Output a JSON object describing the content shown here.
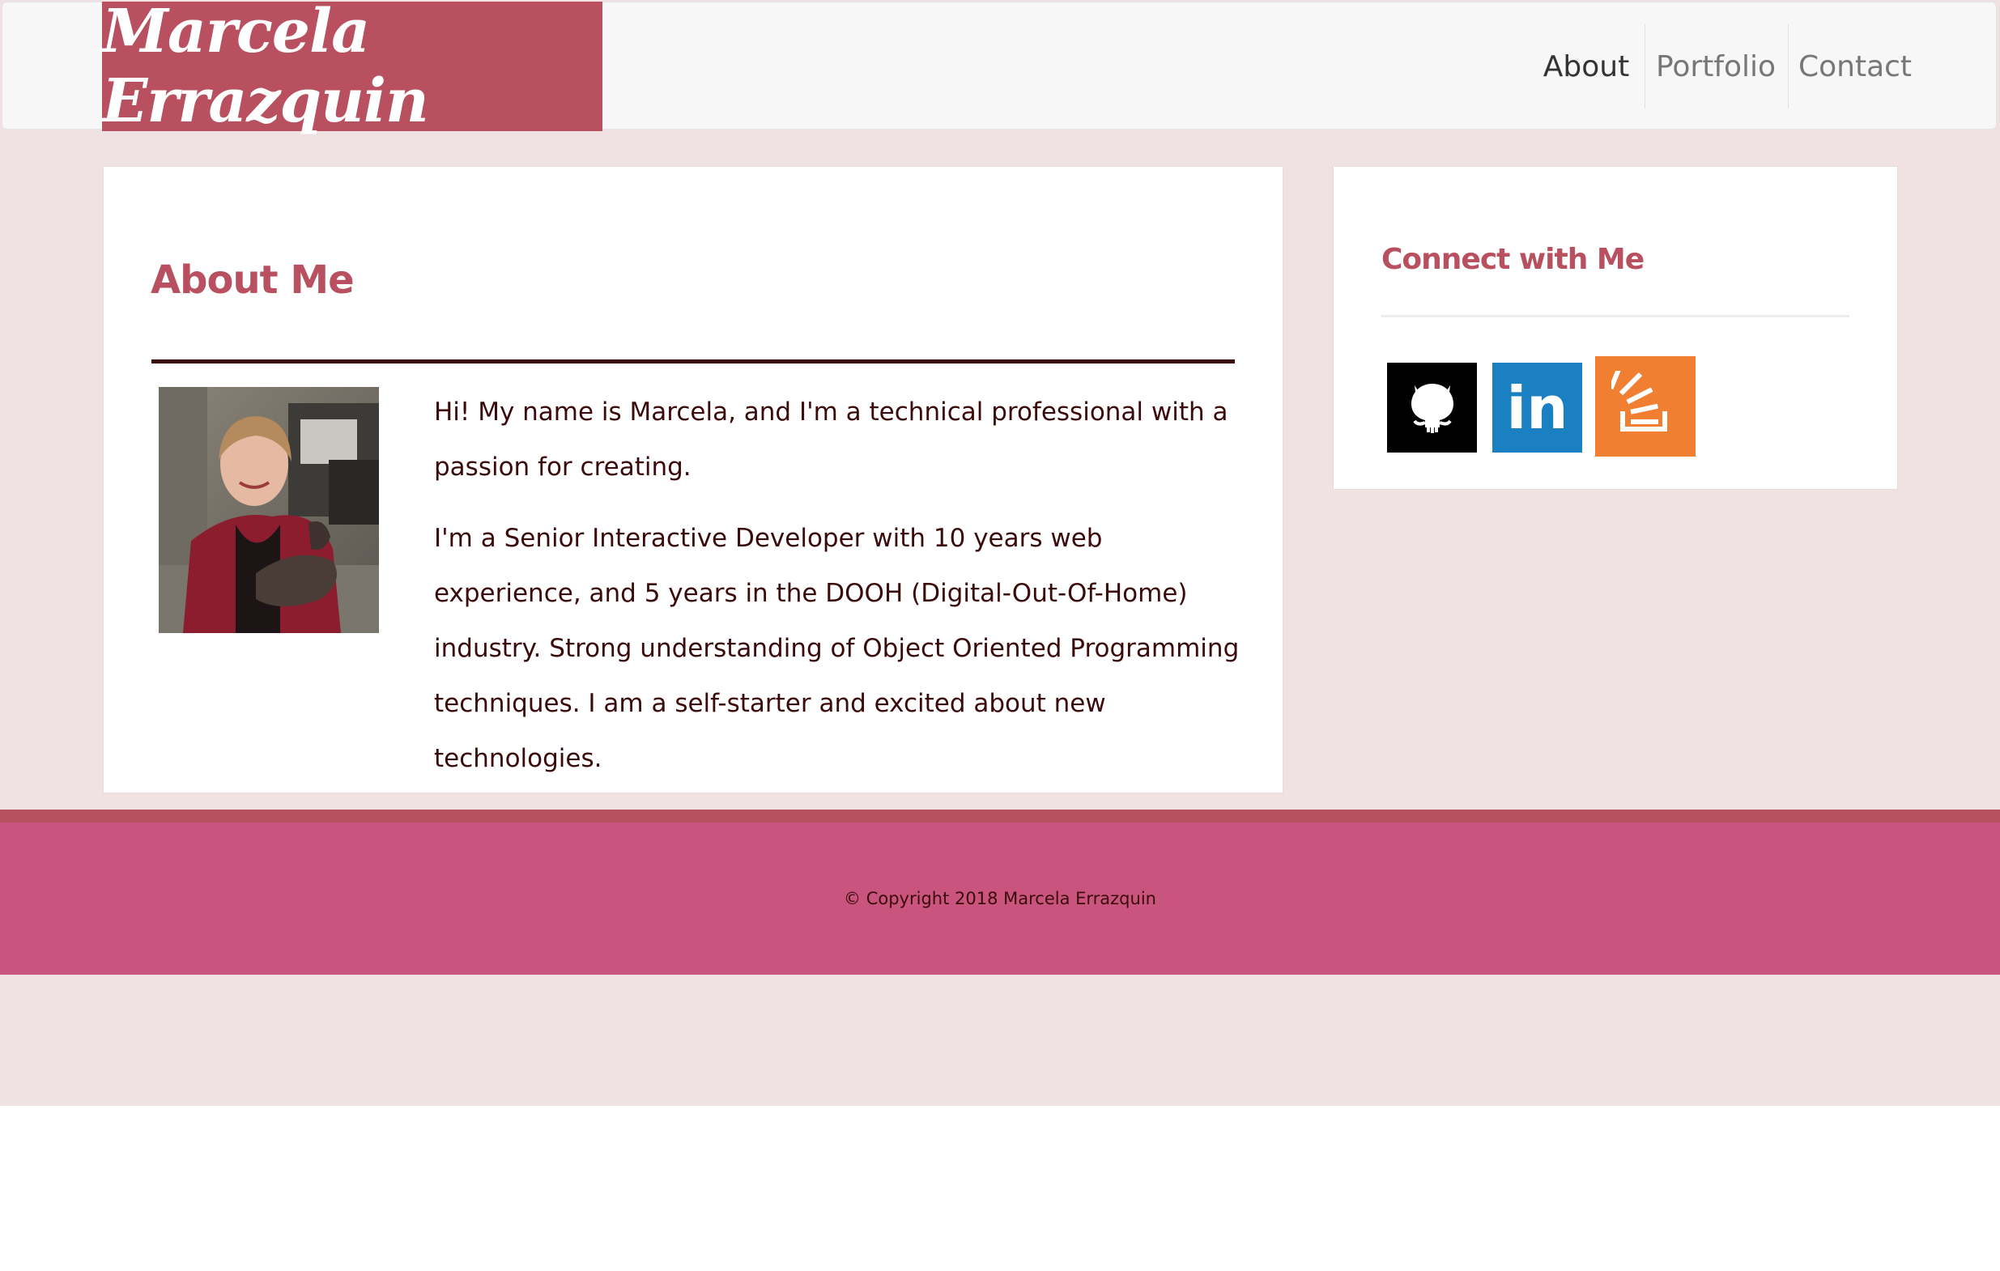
{
  "brand": {
    "name": "Marcela Errazquin"
  },
  "nav": {
    "items": [
      {
        "label": "About",
        "active": true
      },
      {
        "label": "Portfolio",
        "active": false
      },
      {
        "label": "Contact",
        "active": false
      }
    ]
  },
  "about": {
    "title": "About Me",
    "paragraphs": [
      "Hi! My name is Marcela, and I'm a technical professional with a passion for creating.",
      "I'm a Senior Interactive Developer with 10 years web experience, and 5 years in the DOOH (Digital-Out-Of-Home) industry. Strong understanding of Object Oriented Programming techniques. I am a self-starter and excited about new technologies."
    ]
  },
  "sidebar": {
    "title": "Connect with Me",
    "social": [
      {
        "icon": "github-icon",
        "color": "#000000"
      },
      {
        "icon": "linkedin-icon",
        "text": "in",
        "color": "#1a80c2"
      },
      {
        "icon": "stackoverflow-icon",
        "color": "#f07f31"
      }
    ]
  },
  "footer": {
    "copyright": "© Copyright 2018 Marcela Errazquin"
  },
  "colors": {
    "brand": "#b8505f",
    "footer": "#c9557e",
    "page_background": "#f0e1e3",
    "text": "#3b0a0a"
  }
}
